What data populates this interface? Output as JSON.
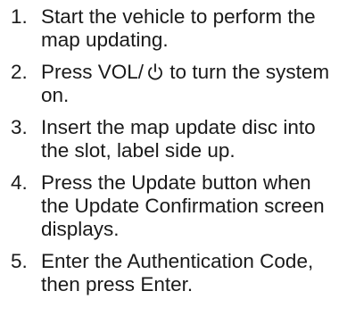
{
  "steps": [
    {
      "number": "1.",
      "text": "Start the vehicle to perform the map updating."
    },
    {
      "number": "2.",
      "text_before": "Press VOL/",
      "icon": "power-icon",
      "text_after": " to turn the system on."
    },
    {
      "number": "3.",
      "text": "Insert the map update disc into the slot, label side up."
    },
    {
      "number": "4.",
      "text": "Press the Update button when the Update Confirmation screen displays."
    },
    {
      "number": "5.",
      "text": "Enter the Authentication Code, then press Enter."
    }
  ]
}
